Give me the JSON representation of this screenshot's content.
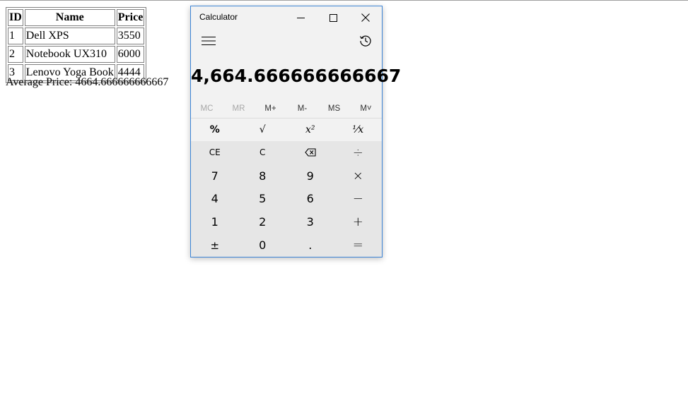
{
  "table": {
    "headers": [
      "ID",
      "Name",
      "Price"
    ],
    "rows": [
      [
        "1",
        "Dell XPS",
        "3550"
      ],
      [
        "2",
        "Notebook UX310",
        "6000"
      ],
      [
        "3",
        "Lenovo Yoga Book",
        "4444"
      ]
    ]
  },
  "average": {
    "label": "Average Price: ",
    "value": "4664.666666666667"
  },
  "calculator": {
    "title": "Calculator",
    "display": "4,664.666666666667",
    "memory": [
      "MC",
      "MR",
      "M+",
      "M-",
      "MS",
      "M˅"
    ],
    "functions": [
      "%",
      "√",
      "x²",
      "⅟x"
    ],
    "keys": [
      [
        "CE",
        "C",
        "⌫",
        "÷"
      ],
      [
        "7",
        "8",
        "9",
        "×"
      ],
      [
        "4",
        "5",
        "6",
        "−"
      ],
      [
        "1",
        "2",
        "3",
        "+"
      ],
      [
        "±",
        "0",
        ".",
        "="
      ]
    ],
    "icons": {
      "minimize": "minimize-icon",
      "maximize": "maximize-icon",
      "close": "close-icon",
      "menu": "hamburger-menu-icon",
      "history": "history-icon",
      "backspace": "backspace-icon"
    },
    "colors": {
      "accent_border": "#3c84d6",
      "panel": "#f2f2f2",
      "keypad": "#e6e6e6"
    }
  }
}
